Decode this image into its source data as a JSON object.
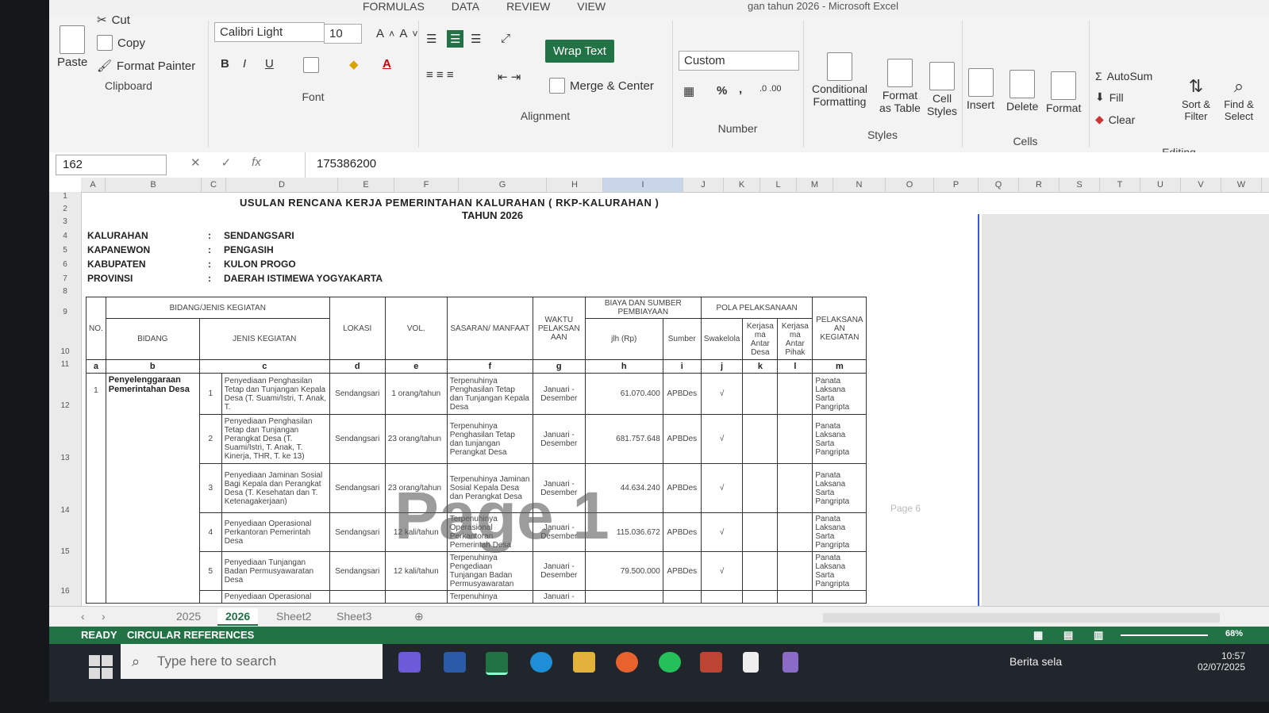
{
  "window": {
    "title": "gan tahun 2026 - Microsoft Excel",
    "help": "?"
  },
  "menu_tabs": [
    "FORMULAS",
    "DATA",
    "REVIEW",
    "VIEW"
  ],
  "clipboard": {
    "paste": "Paste",
    "cut": "Cut",
    "copy": "Copy",
    "format_painter": "Format Painter",
    "label": "Clipboard"
  },
  "font": {
    "name": "Calibri Light",
    "size": "10",
    "label": "Font",
    "bold": "B",
    "italic": "I",
    "underline": "U"
  },
  "alignment": {
    "wrap_text": "Wrap Text",
    "merge_center": "Merge & Center",
    "label": "Alignment"
  },
  "number": {
    "format": "Custom",
    "percent": "%",
    "comma": ",",
    "label": "Number"
  },
  "styles": {
    "conditional": "Conditional Formatting",
    "format_table": "Format as Table",
    "cell_styles": "Cell Styles",
    "label": "Styles"
  },
  "cells": {
    "insert": "Insert",
    "delete": "Delete",
    "format": "Format",
    "label": "Cells"
  },
  "editing": {
    "autosum": "AutoSum",
    "fill": "Fill",
    "clear": "Clear",
    "sort": "Sort & Filter",
    "find": "Find & Select",
    "label": "Editing"
  },
  "formula_bar": {
    "name_box": "162",
    "value": "175386200",
    "fx": "fx"
  },
  "columns": [
    "A",
    "B",
    "C",
    "D",
    "E",
    "F",
    "G",
    "H",
    "I",
    "J",
    "K",
    "L",
    "M",
    "N",
    "O",
    "P",
    "Q",
    "R",
    "S",
    "T",
    "U",
    "V",
    "W"
  ],
  "rows": [
    "1",
    "2",
    "3",
    "4",
    "5",
    "6",
    "7",
    "8",
    "9",
    "10",
    "11",
    "12",
    "13",
    "14",
    "15",
    "16"
  ],
  "doc": {
    "title": "USULAN RENCANA KERJA PEMERINTAHAN KALURAHAN ( RKP-KALURAHAN )",
    "year": "TAHUN 2026",
    "info": [
      {
        "label": "KALURAHAN",
        "value": "SENDANGSARI"
      },
      {
        "label": "KAPANEWON",
        "value": "PENGASIH"
      },
      {
        "label": "KABUPATEN",
        "value": "KULON PROGO"
      },
      {
        "label": "PROVINSI",
        "value": "DAERAH ISTIMEWA YOGYAKARTA"
      }
    ],
    "colon": ":",
    "headers": {
      "no": "NO.",
      "bidang_jenis": "BIDANG/JENIS KEGIATAN",
      "bidang": "BIDANG",
      "jenis": "JENIS KEGIATAN",
      "lokasi": "LOKASI",
      "vol": "VOL.",
      "sasaran": "SASARAN/ MANFAAT",
      "waktu": "WAKTU PELAKSAN AAN",
      "biaya": "BIAYA DAN SUMBER PEMBIAYAAN",
      "jlh": "jlh (Rp)",
      "sumber": "Sumber",
      "pola": "POLA PELAKSANAAN",
      "swakelola": "Swakelola",
      "kerjasama_desa": "Kerjasa ma Antar Desa",
      "kerjasama_pihak": "Kerjasa ma Antar Pihak",
      "pelaksana": "PELAKSANA AN KEGIATAN"
    },
    "letters": [
      "a",
      "b",
      "c",
      "d",
      "e",
      "f",
      "g",
      "h",
      "i",
      "j",
      "k",
      "l",
      "m"
    ],
    "group_no": "1",
    "group_bidang": "Penyelenggaraan Pemerintahan Desa",
    "rows": [
      {
        "no": "1",
        "jenis": "Penyediaan Penghasilan Tetap dan Tunjangan Kepala Desa (T. Suami/Istri, T. Anak, T.",
        "lokasi": "Sendangsari",
        "vol": "1 orang/tahun",
        "sasaran": "Terpenuhinya Penghasilan Tetap dan Tunjangan Kepala Desa",
        "waktu": "Januari - Desember",
        "jlh": "61.070.400",
        "sumber": "APBDes",
        "swakelola": "√",
        "pelaksana": "Panata Laksana Sarta Pangripta"
      },
      {
        "no": "2",
        "jenis": "Penyediaan Penghasilan Tetap dan Tunjangan Perangkat Desa (T. Suami/Istri, T. Anak, T. Kinerja, THR, T. ke 13)",
        "lokasi": "Sendangsari",
        "vol": "23 orang/tahun",
        "sasaran": "Terpenuhinya Penghasilan Tetap dan tunjangan Perangkat Desa",
        "waktu": "Januari - Desember",
        "jlh": "681.757.648",
        "sumber": "APBDes",
        "swakelola": "√",
        "pelaksana": "Panata Laksana Sarta Pangripta"
      },
      {
        "no": "3",
        "jenis": "Penyediaan Jaminan Sosial Bagi Kepala dan Perangkat Desa (T. Kesehatan dan T. Ketenagakerjaan)",
        "lokasi": "Sendangsari",
        "vol": "23 orang/tahun",
        "sasaran": "Terpenuhinya Jaminan Sosial Kepala Desa dan Perangkat Desa",
        "waktu": "Januari - Desember",
        "jlh": "44.634.240",
        "sumber": "APBDes",
        "swakelola": "√",
        "pelaksana": "Panata Laksana Sarta Pangripta"
      },
      {
        "no": "4",
        "jenis": "Penyediaan Operasional Perkantoran Pemerintah Desa",
        "lokasi": "Sendangsari",
        "vol": "12 kali/tahun",
        "sasaran": "Terpenuhinya Operasional Perkantoran Pemerintah Desa",
        "waktu": "Januari - Desember",
        "jlh": "115.036.672",
        "sumber": "APBDes",
        "swakelola": "√",
        "pelaksana": "Panata Laksana Sarta Pangripta"
      },
      {
        "no": "5",
        "jenis": "Penyediaan Tunjangan Badan Permusyawaratan Desa",
        "lokasi": "Sendangsari",
        "vol": "12 kali/tahun",
        "sasaran": "Terpenuhinya Pengediaan Tunjangan Badan Permusyawaratan",
        "waktu": "Januari - Desember",
        "jlh": "79.500.000",
        "sumber": "APBDes",
        "swakelola": "√",
        "pelaksana": "Panata Laksana Sarta Pangripta"
      },
      {
        "no": "",
        "jenis": "Penyediaan Operasional",
        "lokasi": "",
        "vol": "",
        "sasaran": "Terpenuhinya",
        "waktu": "Januari -",
        "jlh": "",
        "sumber": "",
        "swakelola": "",
        "pelaksana": ""
      }
    ],
    "watermark": "Page 1",
    "page6": "Page 6"
  },
  "sheet_tabs": [
    "2025",
    "2026",
    "Sheet2",
    "Sheet3"
  ],
  "active_sheet": "2026",
  "status": {
    "ready": "READY",
    "circular": "CIRCULAR REFERENCES",
    "zoom": "68%"
  },
  "taskbar": {
    "search_placeholder": "Type here to search",
    "news": "Berita sela",
    "time": "10:57",
    "date": "02/07/2025"
  }
}
